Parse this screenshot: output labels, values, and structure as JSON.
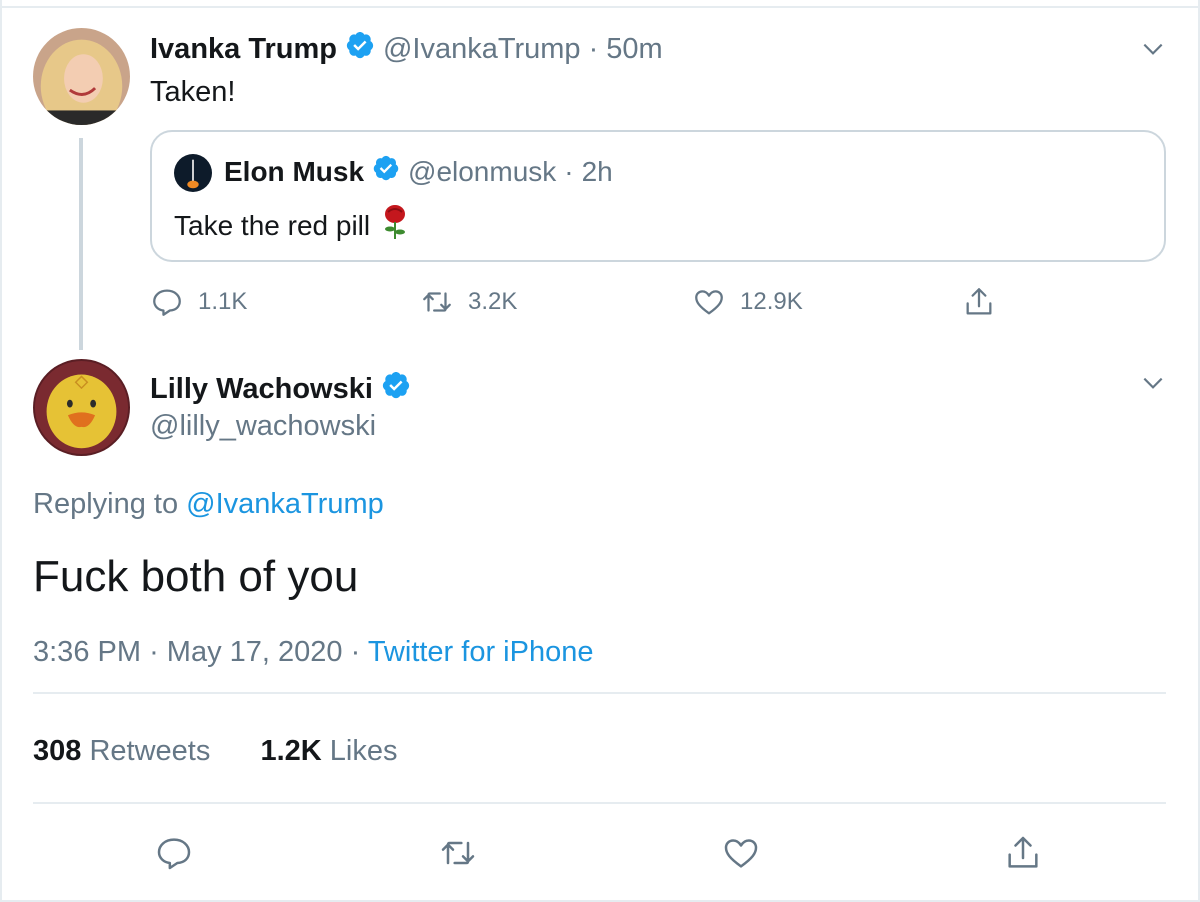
{
  "thread": {
    "tweet1": {
      "author_name": "Ivanka Trump",
      "handle": "@IvankaTrump",
      "separator": "·",
      "time": "50m",
      "text": "Taken!",
      "quote": {
        "author_name": "Elon Musk",
        "handle": "@elonmusk",
        "separator": "·",
        "time": "2h",
        "text": "Take the red pill",
        "emoji": "rose-emoji"
      },
      "actions": {
        "replies": "1.1K",
        "retweets": "3.2K",
        "likes": "12.9K"
      }
    },
    "tweet2": {
      "author_name": "Lilly Wachowski",
      "handle": "@lilly_wachowski",
      "replying_prefix": "Replying to",
      "replying_to": "@IvankaTrump",
      "text": "Fuck both of you",
      "time": "3:36 PM",
      "date": "May 17, 2020",
      "separator": "·",
      "source": "Twitter for iPhone",
      "retweet_count": "308",
      "retweet_label": "Retweets",
      "like_count": "1.2K",
      "like_label": "Likes"
    }
  },
  "icons": {
    "verified": "verified-badge-icon",
    "more": "chevron-down-icon",
    "reply": "reply-icon",
    "retweet": "retweet-icon",
    "like": "heart-icon",
    "share": "share-icon"
  },
  "colors": {
    "text": "#14171a",
    "muted": "#657786",
    "link": "#1b95e0",
    "verified": "#1da1f2",
    "border": "#e6ecf0"
  }
}
